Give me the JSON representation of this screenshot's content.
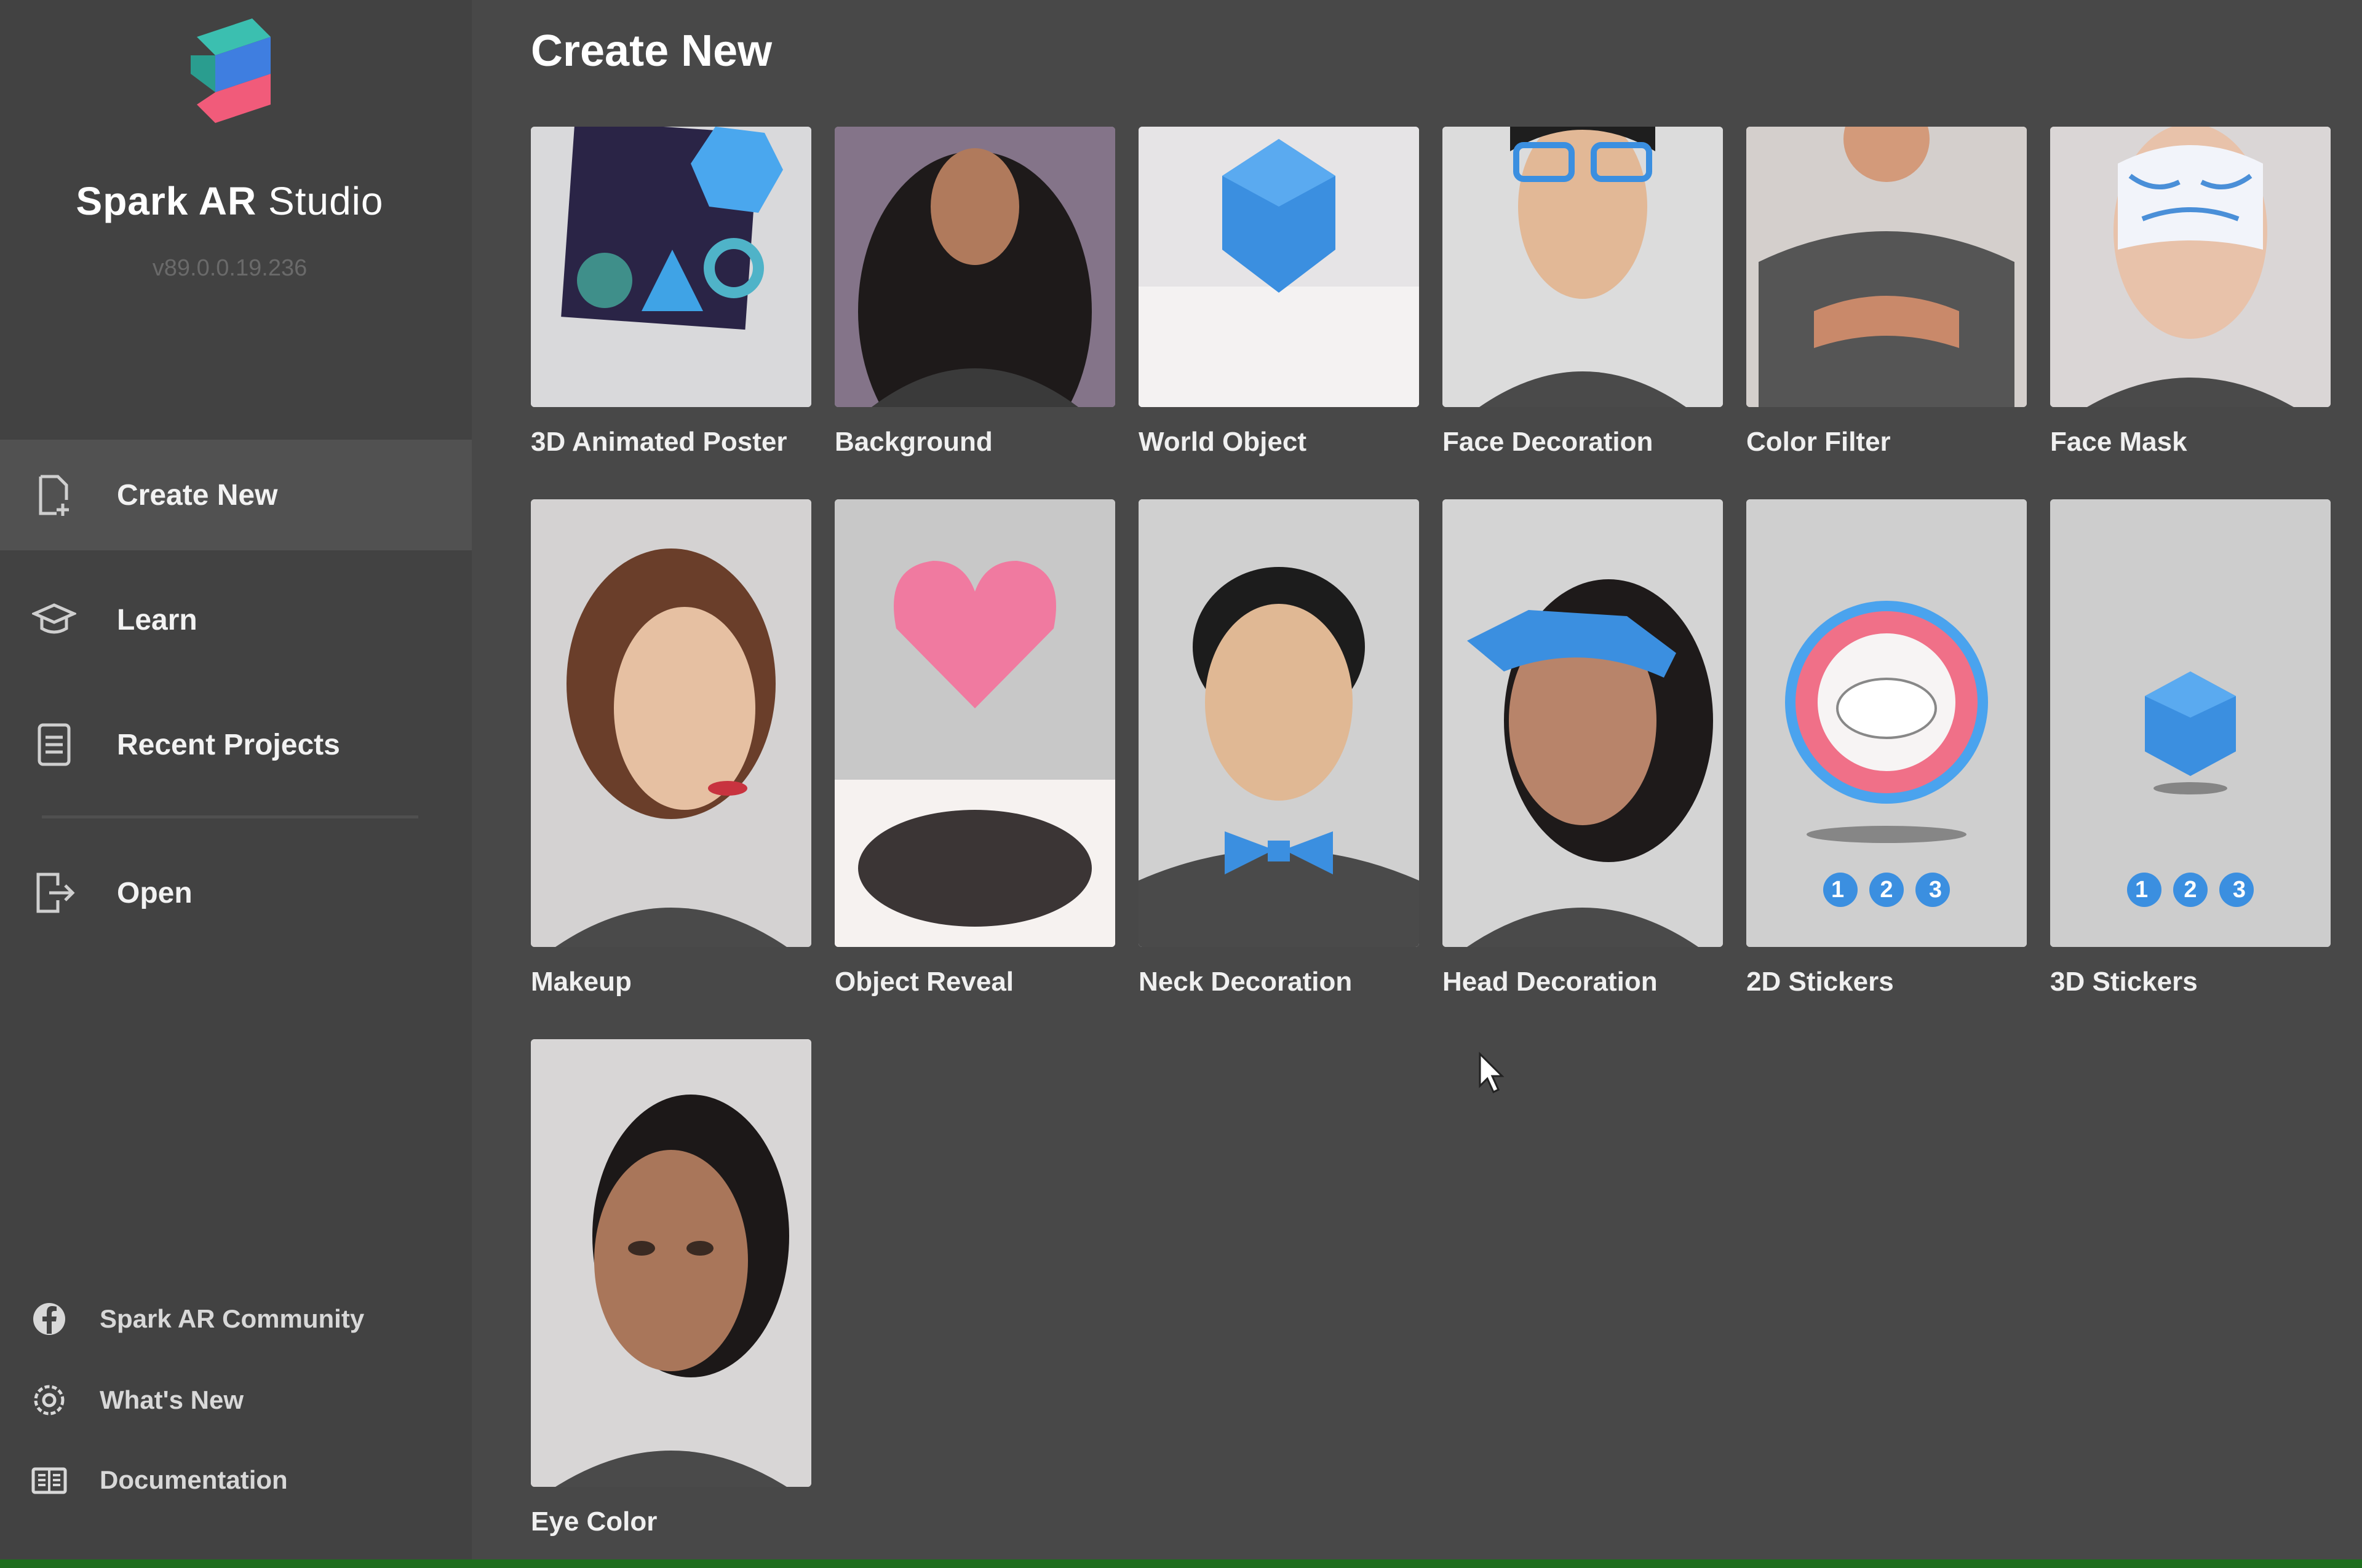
{
  "app": {
    "name_bold": "Spark AR",
    "name_light": "Studio",
    "version": "v89.0.0.19.236"
  },
  "sidebar": {
    "nav": [
      {
        "label": "Create New",
        "icon": "new-file-icon",
        "active": true
      },
      {
        "label": "Learn",
        "icon": "graduation-cap-icon",
        "active": false
      },
      {
        "label": "Recent Projects",
        "icon": "document-icon",
        "active": false
      },
      {
        "label": "Open",
        "icon": "open-file-icon",
        "active": false
      }
    ],
    "footer": [
      {
        "label": "Spark AR Community",
        "icon": "facebook-icon"
      },
      {
        "label": "What's New",
        "icon": "gear-icon"
      },
      {
        "label": "Documentation",
        "icon": "book-icon"
      }
    ]
  },
  "main": {
    "title": "Create New",
    "templates": [
      {
        "label": "3D Animated Poster"
      },
      {
        "label": "Background"
      },
      {
        "label": "World Object"
      },
      {
        "label": "Face Decoration"
      },
      {
        "label": "Color Filter"
      },
      {
        "label": "Face Mask"
      },
      {
        "label": "Makeup"
      },
      {
        "label": "Object Reveal"
      },
      {
        "label": "Neck Decoration"
      },
      {
        "label": "Head Decoration"
      },
      {
        "label": "2D Stickers",
        "badges": [
          "1",
          "2",
          "3"
        ]
      },
      {
        "label": "3D Stickers",
        "badges": [
          "1",
          "2",
          "3"
        ]
      },
      {
        "label": "Eye Color"
      }
    ]
  },
  "colors": {
    "background": "#484848",
    "sidebar": "#424242",
    "active_nav": "#515151",
    "accent_blue": "#3a8fd6"
  }
}
